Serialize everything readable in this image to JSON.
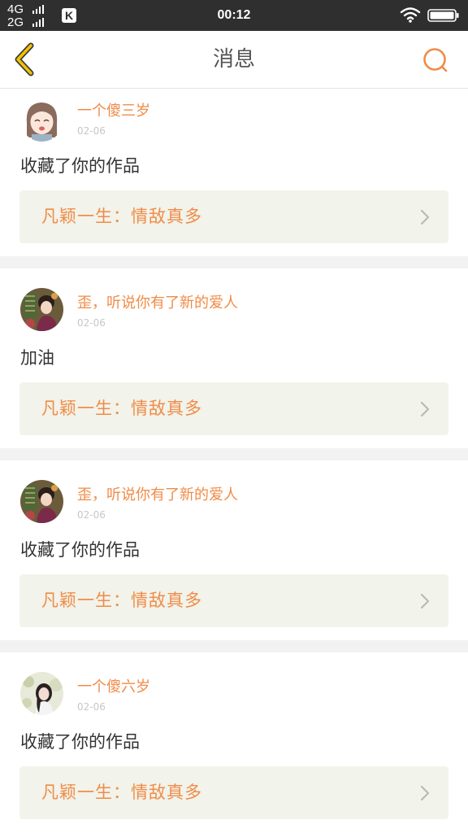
{
  "status_bar": {
    "network_top": "4G",
    "network_bottom": "2G",
    "app_badge": "K",
    "time": "00:12",
    "icons": [
      "k-app-icon",
      "wifi-icon",
      "battery-icon"
    ]
  },
  "header": {
    "title": "消息",
    "back_icon": "chevron-left-icon",
    "search_icon": "search-icon"
  },
  "colors": {
    "accent": "#f08c48",
    "back_icon": "#f2c200",
    "card_background": "#f2f3ea",
    "divider": "#f2f2f2",
    "status_bar": "#2f2f2f"
  },
  "messages": [
    {
      "username": "一个傻三岁",
      "date": "02-06",
      "text": "收藏了你的作品",
      "work_title": "凡颖一生：情敌真多",
      "avatar": "anime-girl-avatar"
    },
    {
      "username": "歪，听说你有了新的爱人",
      "date": "02-06",
      "text": "加油",
      "work_title": "凡颖一生：情敌真多",
      "avatar": "costume-drama-avatar"
    },
    {
      "username": "歪，听说你有了新的爱人",
      "date": "02-06",
      "text": "收藏了你的作品",
      "work_title": "凡颖一生：情敌真多",
      "avatar": "costume-drama-avatar"
    },
    {
      "username": "一个傻六岁",
      "date": "02-06",
      "text": "收藏了你的作品",
      "work_title": "凡颖一生：情敌真多",
      "avatar": "girl-portrait-avatar"
    }
  ]
}
